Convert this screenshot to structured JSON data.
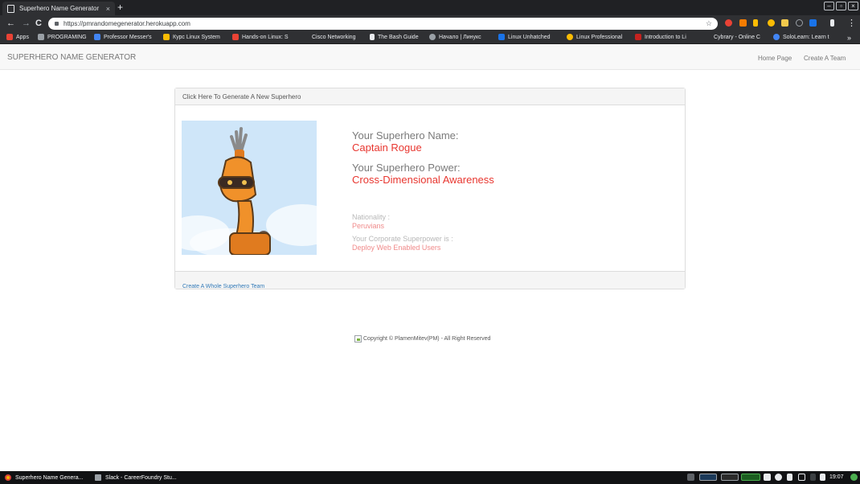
{
  "browser": {
    "tab_title": "Superhero Name Generator",
    "tab_close": "×",
    "new_tab": "+",
    "url": "https://pmrandomegenerator.herokuapp.com",
    "nav_back": "←",
    "nav_forward": "→",
    "nav_reload": "C",
    "menu": "⋮",
    "bookmarks": [
      {
        "label": "Apps",
        "color": "#e94235"
      },
      {
        "label": "PROGRAMING",
        "color": "#9aa0a6"
      },
      {
        "label": "Professor Messer's",
        "color": "#4285f4"
      },
      {
        "label": "Курс Linux System",
        "color": "#fbbc04"
      },
      {
        "label": "Hands-on Linux: S",
        "color": "#ea4335"
      },
      {
        "label": "Cisco Networking",
        "color": "#2f3033"
      },
      {
        "label": "The Bash Guide",
        "color": "#e8eaed"
      },
      {
        "label": "Начало | Линукс",
        "color": "#9aa0a6"
      },
      {
        "label": "Linux Unhatched",
        "color": "#1a73e8"
      },
      {
        "label": "Linux Professional",
        "color": "#fbbc04"
      },
      {
        "label": "Introduction to Li",
        "color": "#c5221f"
      },
      {
        "label": "Cybrary - Online C",
        "color": "#2f3033"
      },
      {
        "label": "SoloLearn: Learn t",
        "color": "#4285f4"
      }
    ],
    "bookmarks_overflow": "»"
  },
  "navbar": {
    "brand": "SUPERHERO NAME GENERATOR",
    "links": [
      "Home Page",
      "Create A Team"
    ]
  },
  "panel": {
    "heading": "Click Here To Generate A New Superhero",
    "name_label": "Your Superhero Name:",
    "name_value": "Captain Rogue",
    "power_label": "Your Superhero Power:",
    "power_value": "Cross-Dimensional Awareness",
    "nationality_label": "Nationality :",
    "nationality_value": "Peruvians",
    "corporate_label": "Your Corporate Superpower is :",
    "corporate_value": "Deploy Web Enabled Users",
    "footer_link": "Create A Whole Superhero Team"
  },
  "footer": {
    "copyright": "Copyright © PlamenMitev(PM) - All Right Reserved"
  },
  "taskbar": {
    "tasks": [
      "Superhero Name Genera...",
      "Slack - CareerFoundry Stu..."
    ],
    "clock": "19:07"
  },
  "colors": {
    "accent_red": "#e8362f",
    "light_red": "#f08a8a",
    "link_blue": "#337ab7",
    "robot_orange": "#f0912a",
    "sky_blue": "#cfe6f9"
  }
}
